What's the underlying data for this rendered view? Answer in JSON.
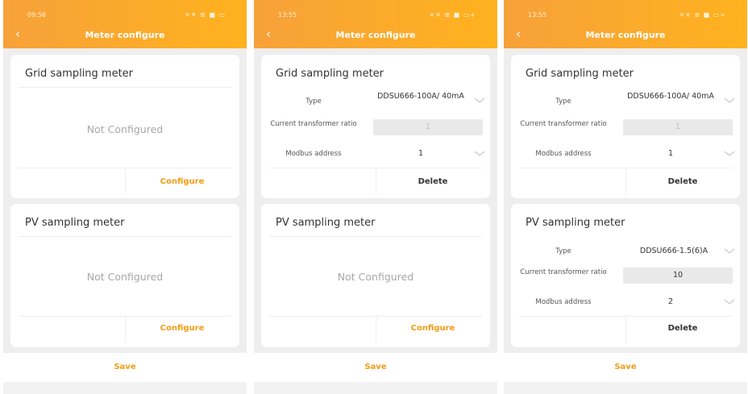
{
  "screens": [
    {
      "time": "09:56",
      "status_icons": "✕✕ ≣ ■ ▭",
      "back": "‹",
      "title": "Meter configure",
      "grid": {
        "title": "Grid sampling meter",
        "empty": "Not Configured",
        "action": "Configure"
      },
      "pv": {
        "title": "PV sampling meter",
        "empty": "Not Configured",
        "action": "Configure"
      },
      "save": "Save"
    },
    {
      "time": "13:55",
      "status_icons": "✕✕ ≣ ■ ▭+",
      "back": "‹",
      "title": "Meter configure",
      "grid": {
        "title": "Grid sampling meter",
        "type_label": "Type",
        "type_value": "DDSU666-100A/ 40mA",
        "ct_label": "Current transformer ratio",
        "ct_value": "1",
        "modbus_label": "Modbus address",
        "modbus_value": "1",
        "action": "Delete"
      },
      "pv": {
        "title": "PV sampling meter",
        "empty": "Not Configured",
        "action": "Configure"
      },
      "save": "Save"
    },
    {
      "time": "13:55",
      "status_icons": "✕✕ ≣ ■ ▭+",
      "back": "‹",
      "title": "Meter configure",
      "grid": {
        "title": "Grid sampling meter",
        "type_label": "Type",
        "type_value": "DDSU666-100A/ 40mA",
        "ct_label": "Current transformer ratio",
        "ct_value": "1",
        "modbus_label": "Modbus address",
        "modbus_value": "1",
        "action": "Delete"
      },
      "pv": {
        "title": "PV sampling meter",
        "type_label": "Type",
        "type_value": "DDSU666-1.5(6)A",
        "ct_label": "Current transformer ratio",
        "ct_value": "10",
        "modbus_label": "Modbus address",
        "modbus_value": "2",
        "action": "Delete"
      },
      "save": "Save"
    }
  ],
  "colors": {
    "header_start": "#f7a13a",
    "header_end": "#ffb21e",
    "accent": "#f39c12",
    "background": "#eeeeee"
  }
}
